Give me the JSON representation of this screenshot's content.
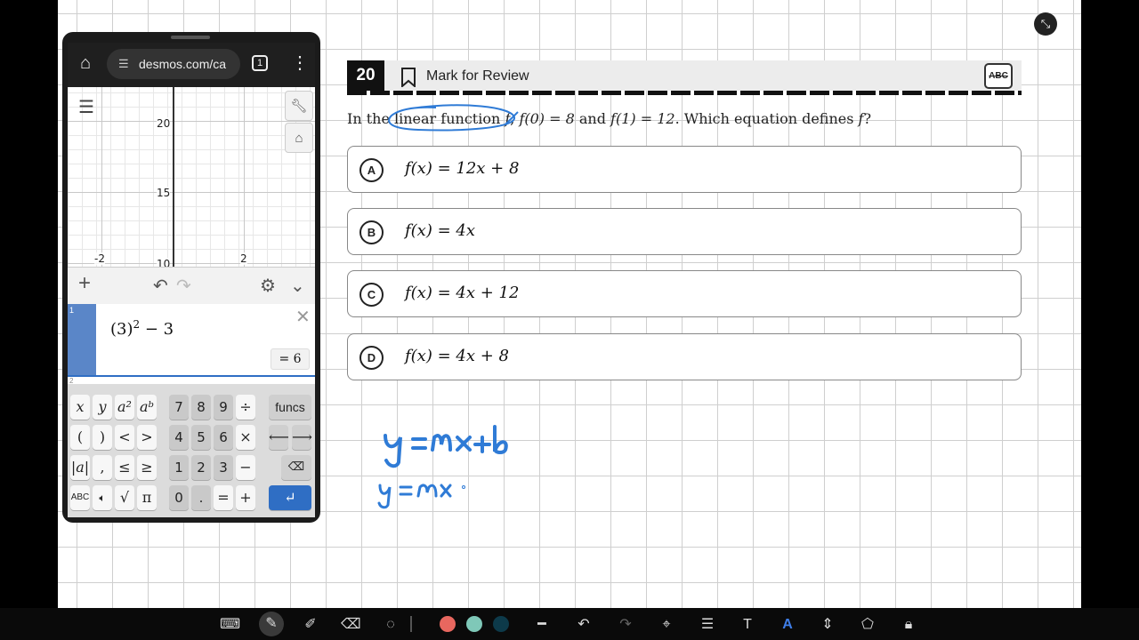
{
  "browser": {
    "url": "desmos.com/ca",
    "tab_count": "1"
  },
  "graph": {
    "y_ticks": [
      "20",
      "15",
      "10"
    ],
    "x_ticks": [
      "-2",
      "2"
    ]
  },
  "expression_list": {
    "row1_index": "1",
    "row1_expression_base": "(3)",
    "row1_expression_exp": "2",
    "row1_expression_tail": " − 3",
    "row1_result": "= 6",
    "row2_index": "2"
  },
  "keypad": {
    "funcs_label": "funcs",
    "abc_label": "ABC",
    "row1": [
      "x",
      "y",
      "a²",
      "aᵇ",
      "7",
      "8",
      "9",
      "÷"
    ],
    "row2": [
      "(",
      ")",
      "<",
      ">",
      "4",
      "5",
      "6",
      "×"
    ],
    "row3": [
      "|a|",
      ",",
      "≤",
      "≥",
      "1",
      "2",
      "3",
      "−"
    ],
    "row4": [
      "√",
      "π",
      "0",
      ".",
      "=",
      "+"
    ]
  },
  "question": {
    "number": "20",
    "mark_for_review": "Mark for Review",
    "abc_toggle": "ABC",
    "text_parts": [
      "In the linear function ",
      "f",
      ", ",
      "f(0) = 8",
      " and ",
      "f(1) = 12",
      ". Which equation defines ",
      "f",
      "?"
    ],
    "choices": [
      {
        "letter": "A",
        "expr": "f(x) = 12x + 8"
      },
      {
        "letter": "B",
        "expr": "f(x) = 4x"
      },
      {
        "letter": "C",
        "expr": "f(x) = 4x + 12"
      },
      {
        "letter": "D",
        "expr": "f(x) = 4x + 8"
      }
    ]
  },
  "handwriting": {
    "line1": "y = mx + b",
    "line2": "y = m x",
    "ink_color": "#2f7bd6"
  },
  "toolbar": {
    "swatches": [
      "#e8675f",
      "#7fc8b8",
      "#0d3a4a"
    ],
    "icons": [
      "keyboard-icon",
      "pen-icon",
      "highlighter-icon",
      "eraser-icon",
      "lasso-icon",
      "swatch-red",
      "swatch-teal",
      "swatch-navy",
      "stroke-width-icon",
      "undo-icon",
      "redo-icon",
      "text-tool-icon",
      "align-icon",
      "text-size-icon",
      "text-style-icon",
      "page-insert-icon",
      "shapes-icon",
      "lock-icon"
    ]
  }
}
